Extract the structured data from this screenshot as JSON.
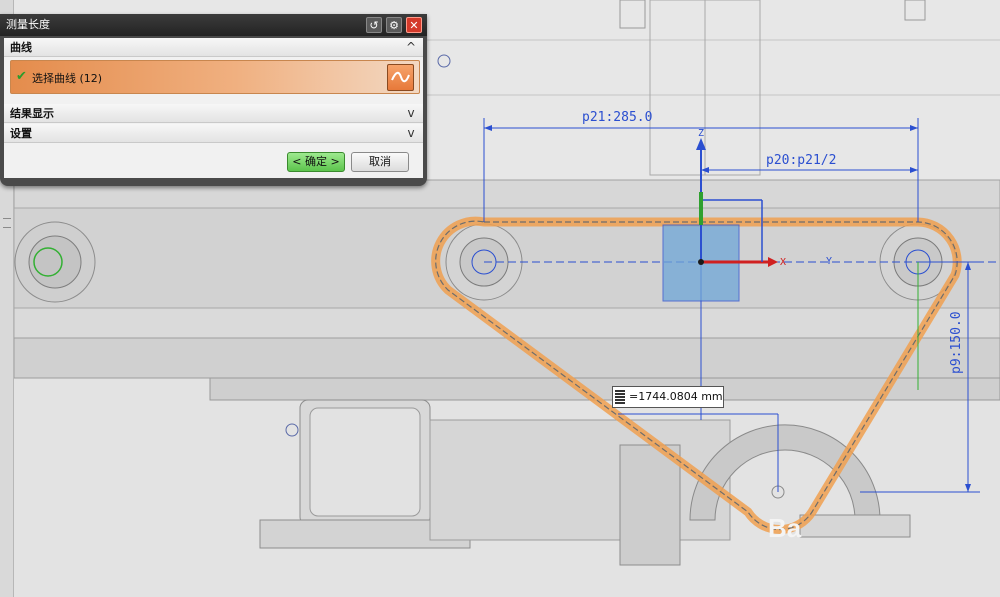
{
  "dialog": {
    "title": "测量长度",
    "close_glyph": "✕",
    "sections": {
      "curve": {
        "title": "曲线",
        "chevron": "^"
      },
      "result": {
        "title": "结果显示",
        "chevron": "v"
      },
      "settings": {
        "title": "设置",
        "chevron": "v"
      }
    },
    "select_curve": {
      "label": "选择曲线 (12)",
      "status_icon": "check-icon"
    },
    "ok_label": "< 确定 >",
    "cancel_label": "取消"
  },
  "viewport": {
    "measurement_result": "=1744.0804 mm",
    "dimensions": {
      "p21": "p21:285.0",
      "p20": "p20:p21/2",
      "p9": "p9:150.0"
    },
    "axes": {
      "x": "X",
      "y": "Y",
      "z": "Z"
    },
    "part_text": "Ba",
    "colors": {
      "selection": "#f0a050",
      "dimension": "#2b4fd0",
      "x_axis": "#d02020",
      "z_axis": "#2b4fd0",
      "datum_fill": "#6fa6d8"
    }
  }
}
